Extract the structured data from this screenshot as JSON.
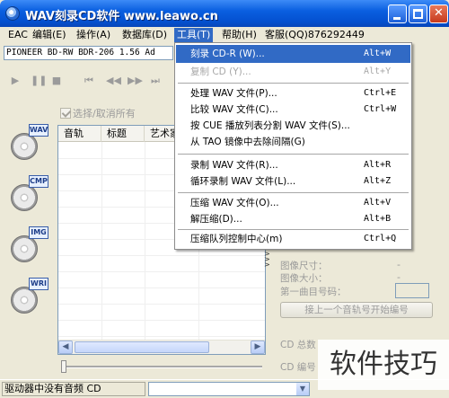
{
  "window": {
    "title": "WAV刻录CD软件 www.leawo.cn",
    "controls": {
      "minimize": "minimize-button",
      "maximize": "maximize-button",
      "close": "close-button"
    }
  },
  "menubar": [
    {
      "label": "EAC"
    },
    {
      "label": "编辑(E)"
    },
    {
      "label": "操作(A)"
    },
    {
      "label": "数据库(D)"
    },
    {
      "label": "工具(T)"
    },
    {
      "label": "帮助(H)"
    },
    {
      "label": "客服(QQ)876292449"
    }
  ],
  "drive": {
    "selected": "PIONEER BD-RW   BDR-206 1.56  Ad"
  },
  "select_all": "选择/取消所有",
  "tools": [
    {
      "tag": "WAV"
    },
    {
      "tag": "CMP"
    },
    {
      "tag": "IMG"
    },
    {
      "tag": "WRI"
    }
  ],
  "track_table": {
    "columns": [
      "音轨",
      "标题",
      "艺术家"
    ]
  },
  "tools_menu": {
    "items": [
      {
        "label": "刻录 CD-R (W)...",
        "shortcut": "Alt+W",
        "state": "highlighted"
      },
      {
        "label": "复制 CD (Y)...",
        "shortcut": "Alt+Y",
        "state": "disabled"
      },
      {
        "label": "处理 WAV 文件(P)...",
        "shortcut": "Ctrl+E",
        "state": "normal"
      },
      {
        "label": "比较 WAV 文件(C)...",
        "shortcut": "Ctrl+W",
        "state": "normal"
      },
      {
        "label": "按 CUE 播放列表分割 WAV 文件(S)...",
        "shortcut": "",
        "state": "normal"
      },
      {
        "label": "从 TAO 镜像中去除间隔(G)",
        "shortcut": "",
        "state": "normal"
      },
      {
        "label": "录制 WAV 文件(R)...",
        "shortcut": "Alt+R",
        "state": "normal"
      },
      {
        "label": "循环录制 WAV 文件(L)...",
        "shortcut": "Alt+Z",
        "state": "normal"
      },
      {
        "label": "压缩 WAV 文件(O)...",
        "shortcut": "Alt+V",
        "state": "normal"
      },
      {
        "label": "解压缩(D)...",
        "shortcut": "Alt+B",
        "state": "normal"
      },
      {
        "label": "压缩队列控制中心(m)",
        "shortcut": "Ctrl+Q",
        "state": "normal"
      }
    ]
  },
  "info_panel": {
    "image_size": "图像尺寸：",
    "image_size_val": "-",
    "file_size": "图像大小：",
    "file_size_val": "-",
    "first_track": "第一曲目号码：",
    "prev_track_button": "接上一个音轨号开始编号",
    "cd_total": "CD 总数",
    "cd_number": "CD 编号"
  },
  "status": {
    "message": "驱动器中没有音频 CD",
    "drive_select": ""
  },
  "watermark": "软件技巧"
}
